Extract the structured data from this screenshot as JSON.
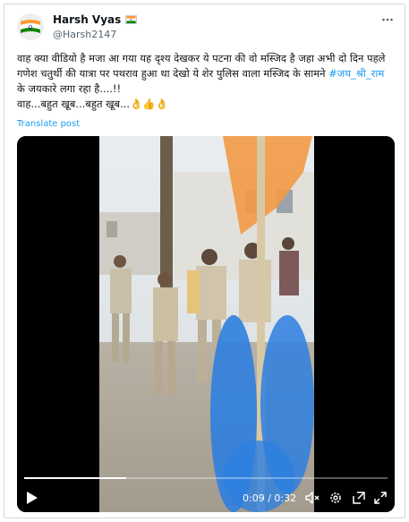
{
  "author": {
    "display_name": "Harsh Vyas",
    "handle": "@Harsh2147"
  },
  "tweet": {
    "text_main": "वाह क्या वीडियो है मजा आ गया यह दृश्य देखकर ये पटना की वो मस्जिद है जहा अभी दो दिन पहले गणेश चतुर्थी की यात्रा पर पथराव हुआ था देखो ये शेर पुलिस वाला मस्जिद के सामने ",
    "hashtag": "#जय_श्री_राम",
    "text_after_hashtag": " के जयकारे लगा रहा है....!!",
    "text_line2": "वाह...बहुत खूब...बहुत खूब...👌👍👌",
    "translate_label": "Translate post"
  },
  "video": {
    "current_time": "0:09",
    "separator": " / ",
    "duration": "0:32",
    "progress_fraction": 0.28
  },
  "icons": {
    "more": "more-icon",
    "play": "play-icon",
    "volume": "volume-muted-icon",
    "settings": "settings-icon",
    "pip": "picture-in-picture-icon",
    "fullscreen": "fullscreen-icon"
  },
  "colors": {
    "hashtag": "#1d9bf0",
    "link": "#1d9bf0",
    "secondary_text": "#536471",
    "flag_saffron": "#ff9933",
    "flag_green": "#138808",
    "flag_chakra": "#000080"
  }
}
